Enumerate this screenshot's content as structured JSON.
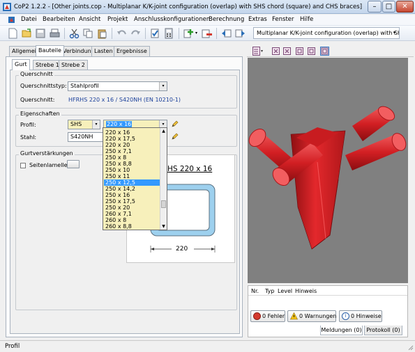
{
  "window": {
    "title": "CoP2 1.2.2 - [Other joints.cop - Multiplanar K/K-joint configuration (overlap) with SHS chord (square) and CHS braces]",
    "minimize": "–",
    "maximize": "□",
    "close": "✕"
  },
  "menu": [
    "Datei",
    "Bearbeiten",
    "Ansicht",
    "Projekt",
    "Anschlusskonfigurationen",
    "Berechnung",
    "Extras",
    "Fenster",
    "Hilfe"
  ],
  "toolbar": {
    "config_select": "Multiplanar K/K-joint configuration (overlap) with SH",
    "arrow": "▾"
  },
  "tabs": [
    "Allgemein",
    "Bauteile",
    "Verbindung",
    "Lasten",
    "Ergebnisse"
  ],
  "subtabs": [
    "Gurt",
    "Strebe 1",
    "Strebe 2"
  ],
  "querschnitt": {
    "group": "Querschnitt",
    "typ_label": "Querschnittstyp:",
    "typ_value": "Stahlprofil",
    "label": "Querschnitt:",
    "value": "HFRHS 220 x 16 / S420NH (EN 10210-1)"
  },
  "eigenschaften": {
    "group": "Eigenschaften",
    "profil_label": "Profil:",
    "profil_type": "SHS",
    "profil_size": "220 x 16",
    "stahl_label": "Stahl:",
    "stahl_value": "S420NH"
  },
  "verstaerkungen": {
    "group": "Gurtverstärkungen",
    "seitenlamellen": "Seitenlamellen"
  },
  "dropdown": {
    "items": [
      "220 x 16",
      "220 x 17,5",
      "220 x 20",
      "250 x 7,1",
      "250 x 8",
      "250 x 8,8",
      "250 x 10",
      "250 x 11",
      "250 x 12,5",
      "250 x 14,2",
      "250 x 16",
      "250 x 17,5",
      "250 x 20",
      "260 x 7,1",
      "260 x 8",
      "260 x 8,8"
    ],
    "selected_index": 8
  },
  "preview": {
    "title": "HS 220 x 16",
    "dimension": "220"
  },
  "messages": {
    "columns": [
      "Nr.",
      "Typ",
      "Level",
      "Hinweis"
    ],
    "fehler": "0 Fehler",
    "warnungen": "0 Warnungen",
    "hinweise": "0 Hinweise",
    "tab_meldungen": "Meldungen (0)",
    "tab_protokoll": "Protokoll (0)"
  },
  "status": "Profil",
  "colors": {
    "selection": "#3399ff",
    "dropdown_bg": "#f7f0bb",
    "model_red": "#e0262a",
    "viewport_bg": "#808080"
  }
}
